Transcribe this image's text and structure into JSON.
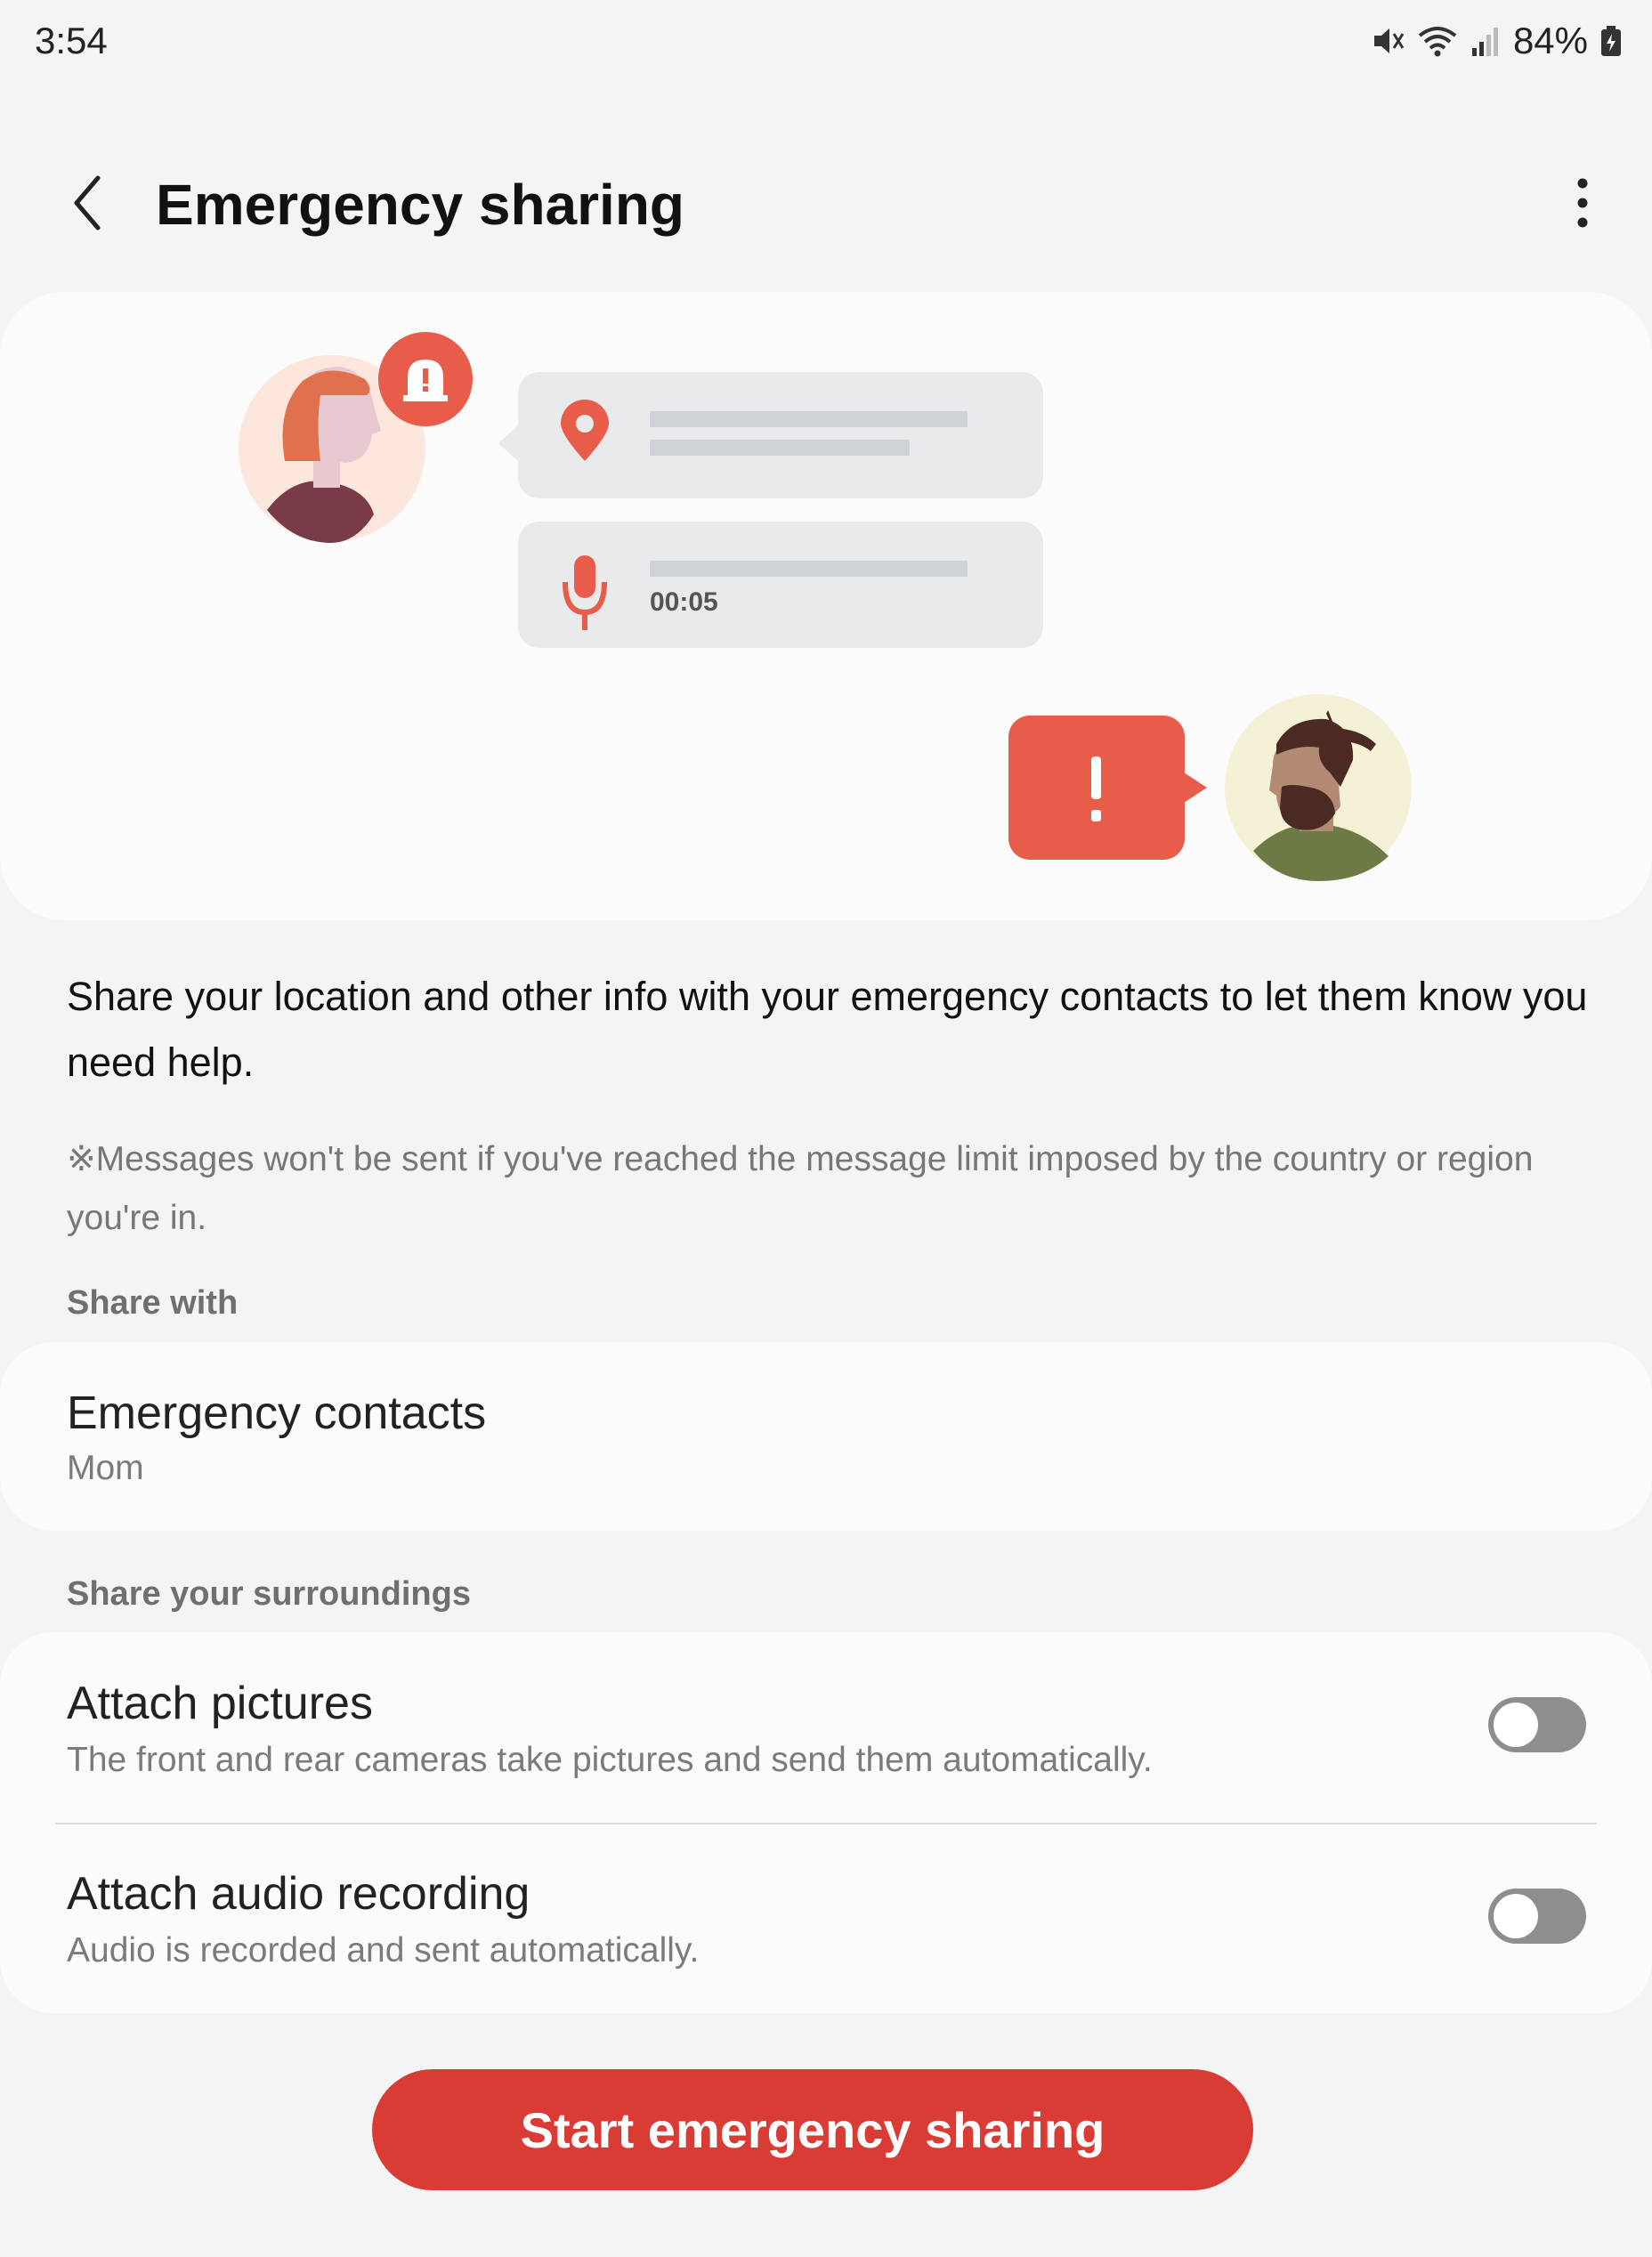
{
  "status_bar": {
    "time": "3:54",
    "battery": "84%",
    "icons": [
      "mute-icon",
      "wifi-icon",
      "signal-icon",
      "battery-charging-icon"
    ]
  },
  "header": {
    "title": "Emergency sharing",
    "back_icon": "back-chevron-icon",
    "more_icon": "more-options-icon"
  },
  "illustration": {
    "timer": "00:05",
    "accent_color": "#e85c4a"
  },
  "description": "Share your location and other info with your emergency contacts to let them know you need help.",
  "note": "※Messages won't be sent if you've reached the message limit imposed by the country or region you're in.",
  "share_with": {
    "label": "Share with",
    "item": {
      "title": "Emergency contacts",
      "subtitle": "Mom"
    }
  },
  "surroundings": {
    "label": "Share your surroundings",
    "items": [
      {
        "title": "Attach pictures",
        "subtitle": "The front and rear cameras take pictures and send them automatically.",
        "enabled": false
      },
      {
        "title": "Attach audio recording",
        "subtitle": "Audio is recorded and sent automatically.",
        "enabled": false
      }
    ]
  },
  "primary_button": {
    "label": "Start emergency sharing",
    "color": "#d93b35"
  }
}
